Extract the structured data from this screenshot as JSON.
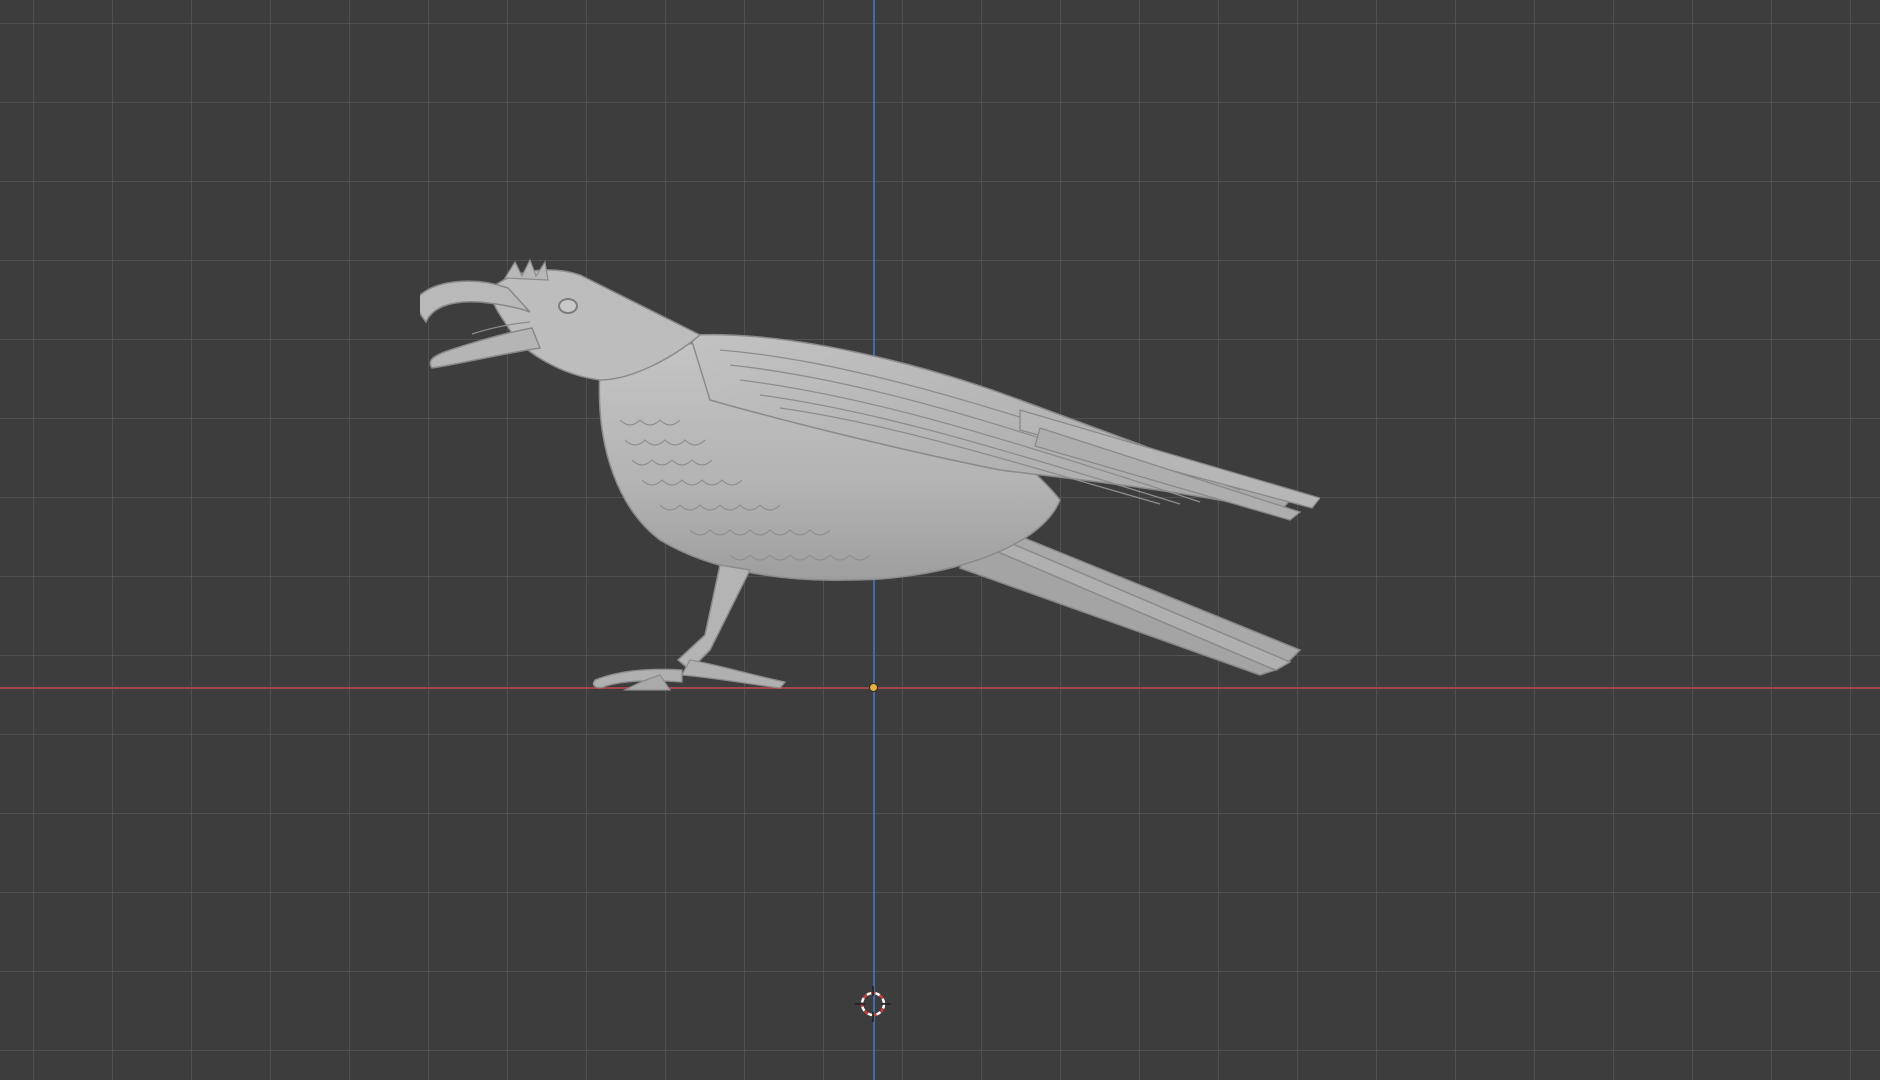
{
  "viewport": {
    "background_color": "#3d3d3d",
    "grid_color": "#5f5f5f",
    "x_axis_color": "#a3454b",
    "z_axis_color": "#3f6ea8"
  },
  "scene": {
    "object": {
      "icon": "raven-model",
      "color": "#b8b8b8"
    },
    "origin": {
      "icon": "object-origin-dot",
      "color": "#e8b23a"
    },
    "cursor_3d": {
      "icon": "3d-cursor-icon",
      "colors": [
        "#d43b3b",
        "#ffffff"
      ]
    }
  }
}
